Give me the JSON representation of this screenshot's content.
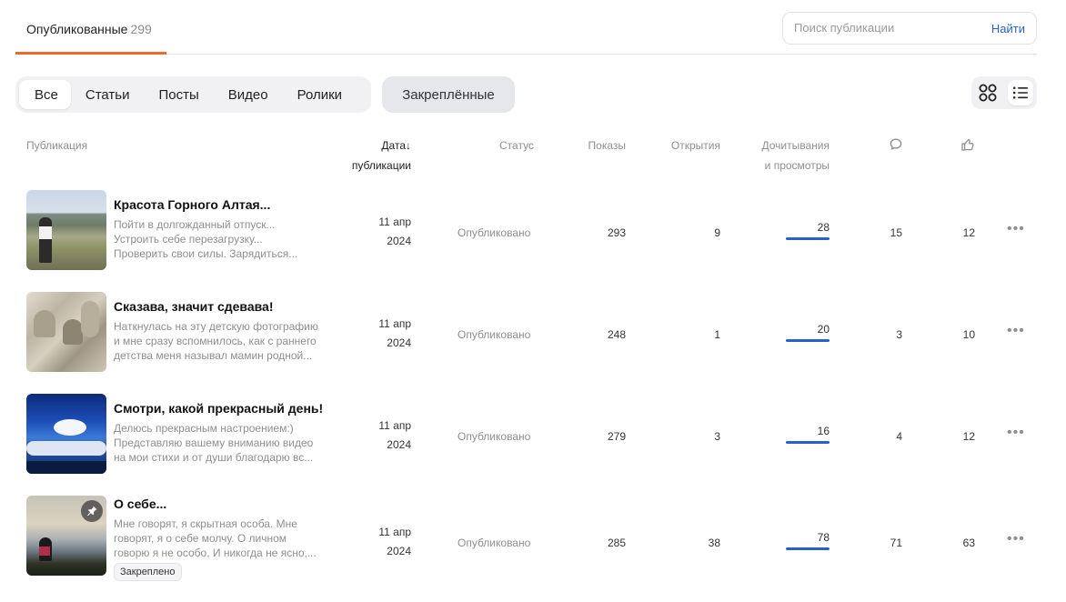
{
  "header": {
    "tab_label": "Опубликованные",
    "tab_count": "299",
    "search_placeholder": "Поиск публикации",
    "search_button": "Найти"
  },
  "filters": {
    "items": [
      "Все",
      "Статьи",
      "Посты",
      "Видео",
      "Ролики"
    ],
    "active": "Все",
    "pinned_label": "Закреплённые"
  },
  "view_toggle": {
    "active": "list",
    "options": [
      "grid-icon",
      "list-icon"
    ]
  },
  "columns": {
    "publication": "Публикация",
    "date_line1": "Дата",
    "date_arrow": "↓",
    "date_line2": "публикации",
    "status": "Статус",
    "views": "Показы",
    "opens": "Открытия",
    "reads_line1": "Дочитывания",
    "reads_line2": "и просмотры",
    "comments_icon": "comment-icon",
    "likes_icon": "thumbs-up-icon"
  },
  "accent_colors": {
    "tab_underline": "#ee6a2a",
    "link": "#2761c6",
    "progress": "#2761c6"
  },
  "rows": [
    {
      "title": "Красота Горного Алтая...",
      "desc": [
        "Пойти в долгожданный отпуск...",
        "Устроить себе перезагрузку...",
        "Проверить свои силы. Зарядиться..."
      ],
      "date_day": "11 апр",
      "date_year": "2024",
      "status": "Опубликовано",
      "views": "293",
      "opens": "9",
      "reads": "28",
      "comments": "15",
      "likes": "12",
      "pinned": false
    },
    {
      "title": "Сказава, значит сдевава!",
      "desc": [
        "Наткнулась на эту детскую фотографию,",
        "и мне сразу вспомнилось, как с раннего",
        "детства меня называл мамин родной..."
      ],
      "date_day": "11 апр",
      "date_year": "2024",
      "status": "Опубликовано",
      "views": "248",
      "opens": "1",
      "reads": "20",
      "comments": "3",
      "likes": "10",
      "pinned": false
    },
    {
      "title": "Смотри, какой прекрасный день!",
      "desc": [
        "Делюсь прекрасным настроением:)",
        "Представляю вашему вниманию видео",
        "на мои стихи и от души благодарю вс..."
      ],
      "date_day": "11 апр",
      "date_year": "2024",
      "status": "Опубликовано",
      "views": "279",
      "opens": "3",
      "reads": "16",
      "comments": "4",
      "likes": "12",
      "pinned": false
    },
    {
      "title": "О себе...",
      "desc": [
        "Мне говорят, я скрытная особа. Мне",
        "говорят, я о себе молчу. О личном",
        "говорю я не особо, И никогда не ясно,..."
      ],
      "date_day": "11 апр",
      "date_year": "2024",
      "status": "Опубликовано",
      "views": "285",
      "opens": "38",
      "reads": "78",
      "comments": "71",
      "likes": "63",
      "pinned": true,
      "pinned_label": "Закреплено"
    }
  ]
}
